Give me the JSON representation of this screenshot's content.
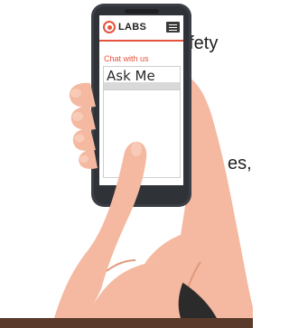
{
  "background_text": {
    "fragment_1": "safety",
    "fragment_2": "es,"
  },
  "phone": {
    "brand": {
      "name": "LABS",
      "logo_icon": "labs-logo-icon"
    },
    "menu_icon": "hamburger-menu-icon",
    "chat_label": "Chat with us",
    "input": {
      "value": "Ask Me"
    }
  },
  "colors": {
    "accent": "#e5533f",
    "skin": "#f4b9a0",
    "phone_body": "#3b3f45",
    "ground": "#5a3a2a"
  }
}
